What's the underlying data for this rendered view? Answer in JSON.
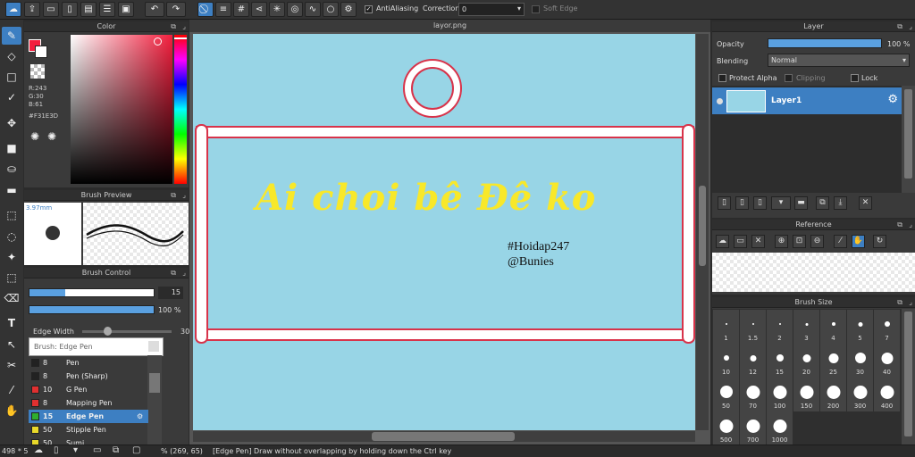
{
  "toolbar": {
    "antialiasing_label": "AntiAliasing",
    "correction_label": "Correction",
    "correction_value": "0",
    "soft_edge_label": "Soft Edge"
  },
  "color_panel": {
    "title": "Color",
    "r": "R:243",
    "g": "G:30",
    "b": "B:61",
    "hex": "#F31E3D",
    "accent": "#f31e3d"
  },
  "brush_preview": {
    "title": "Brush Preview",
    "size": "3.97mm"
  },
  "brush_control": {
    "title": "Brush Control",
    "size_value": "15",
    "opacity_value": "100 %",
    "edge_width_label": "Edge Width",
    "edge_width_value": "30",
    "tooltip": "Brush: Edge Pen",
    "brushes": [
      {
        "size": "8",
        "name": "Pen",
        "color": "#222222"
      },
      {
        "size": "8",
        "name": "Pen (Sharp)",
        "color": "#222222"
      },
      {
        "size": "10",
        "name": "G Pen",
        "color": "#e03030"
      },
      {
        "size": "8",
        "name": "Mapping Pen",
        "color": "#e03030"
      },
      {
        "size": "15",
        "name": "Edge Pen",
        "color": "#2fae2f"
      },
      {
        "size": "50",
        "name": "Stipple Pen",
        "color": "#e8d82a"
      },
      {
        "size": "50",
        "name": "Sumi",
        "color": "#e8d82a"
      }
    ]
  },
  "canvas": {
    "tab_title": "layor.png",
    "headline": "Ai choi bê Đê ko",
    "tag1": "#Hoidap247",
    "tag2": "@Bunies"
  },
  "layer_panel": {
    "title": "Layer",
    "opacity_label": "Opacity",
    "opacity_value": "100 %",
    "blending_label": "Blending",
    "blending_value": "Normal",
    "protect_alpha": "Protect Alpha",
    "clipping": "Clipping",
    "lock": "Lock",
    "layer_name": "Layer1"
  },
  "reference_panel": {
    "title": "Reference"
  },
  "brush_size_panel": {
    "title": "Brush Size",
    "sizes": [
      "1",
      "1.5",
      "2",
      "3",
      "4",
      "5",
      "7",
      "10",
      "12",
      "15",
      "20",
      "25",
      "30",
      "40",
      "50",
      "70",
      "100",
      "150",
      "200",
      "300",
      "400",
      "500",
      "700",
      "1000"
    ]
  },
  "status_bar": {
    "zoom": "498 * 5",
    "coords": "% (269, 65)",
    "message": "[Edge Pen] Draw without overlapping by holding down the Ctrl key"
  }
}
